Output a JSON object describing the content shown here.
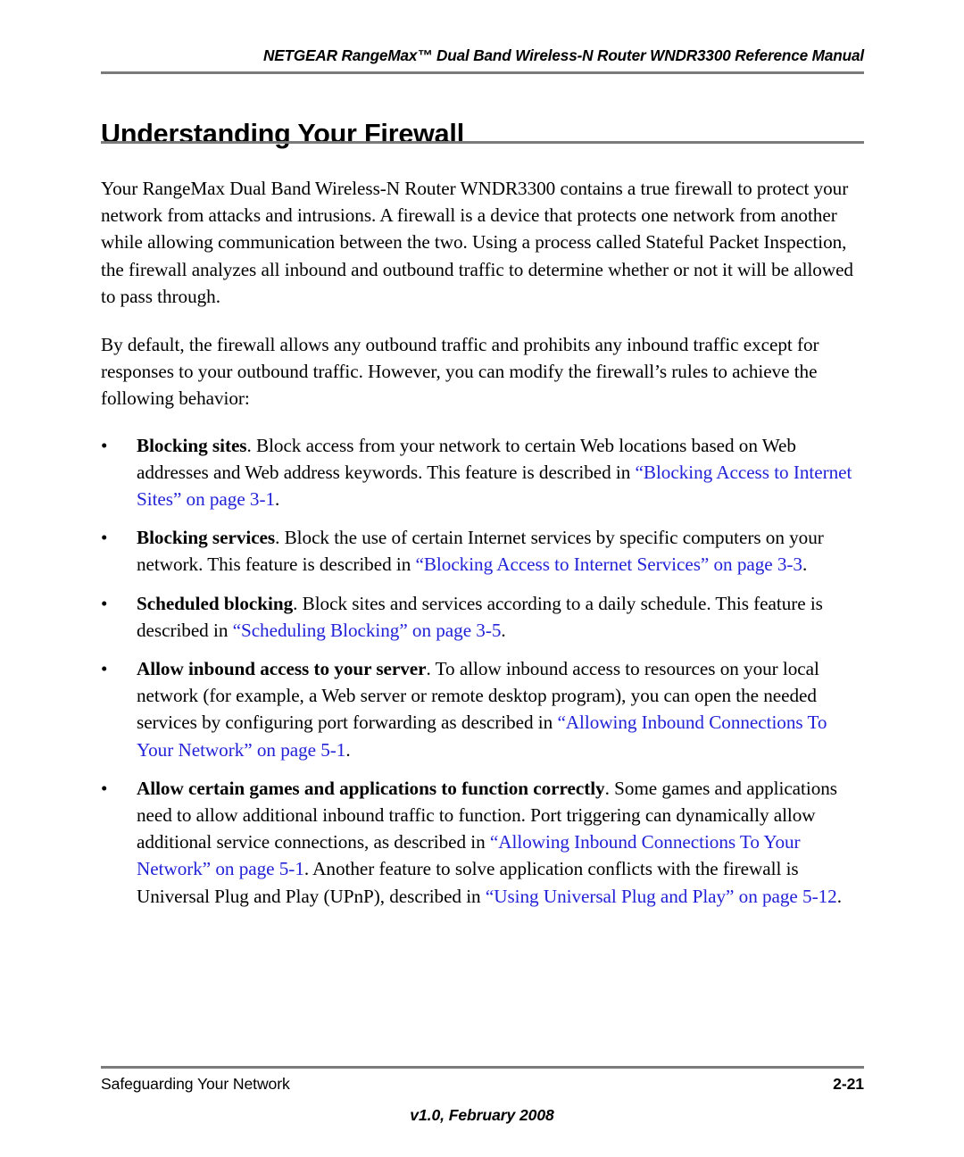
{
  "document": {
    "running_header": "NETGEAR RangeMax™ Dual Band Wireless-N Router WNDR3300 Reference Manual",
    "title": "Understanding Your Firewall",
    "link_color": "#2222d8",
    "rule_color": "#7b7b7b",
    "page_background": "#ffffff",
    "text_color": "#000000"
  },
  "body": {
    "paragraph_1": "Your RangeMax Dual Band Wireless-N Router WNDR3300 contains a true firewall to protect your network from attacks and intrusions. A firewall is a device that protects one network from another while allowing communication between the two. Using a process called Stateful Packet Inspection, the firewall analyzes all inbound and outbound traffic to determine whether or not it will be allowed to pass through.",
    "paragraph_2": "By default, the firewall allows any outbound traffic and prohibits any inbound traffic except for responses to your outbound traffic. However, you can modify the firewall’s rules to achieve the following behavior:"
  },
  "bullets": {
    "marker": "•",
    "items": [
      {
        "lead": "Blocking sites",
        "text_before": ". Block access from your network to certain Web locations based on Web addresses and Web address keywords. This feature is described in ",
        "xref": "“Blocking Access to Internet Sites” on page 3-1",
        "text_after": "."
      },
      {
        "lead": "Blocking services",
        "text_before": ". Block the use of certain Internet services by specific computers on your network. This feature is described in ",
        "xref": "“Blocking Access to Internet Services” on page 3-3",
        "text_after": "."
      },
      {
        "lead": "Scheduled blocking",
        "text_before": ". Block sites and services according to a daily schedule. This feature is described in ",
        "xref": "“Scheduling Blocking” on page 3-5",
        "text_after": "."
      },
      {
        "lead": "Allow inbound access to your server",
        "text_before": ". To allow inbound access to resources on your local network (for example, a Web server or remote desktop program), you can open the needed services by configuring port forwarding as described in ",
        "xref": "“Allowing Inbound Connections To Your Network” on page 5-1",
        "text_after": "."
      },
      {
        "lead": "Allow certain games and applications to function correctly",
        "text_before": ". Some games and applications need to allow additional inbound traffic to function. Port triggering can dynamically allow additional service connections, as described in ",
        "xref": "“Allowing Inbound Connections To Your Network” on page 5-1",
        "text_after": ". Another feature to solve application conflicts with the firewall is Universal Plug and Play (UPnP), described in ",
        "xref2": "“Using Universal Plug and Play” on page 5-12",
        "text_after2": "."
      }
    ]
  },
  "footer": {
    "left": "Safeguarding Your Network",
    "right": "2-21",
    "center": "v1.0, February 2008"
  }
}
